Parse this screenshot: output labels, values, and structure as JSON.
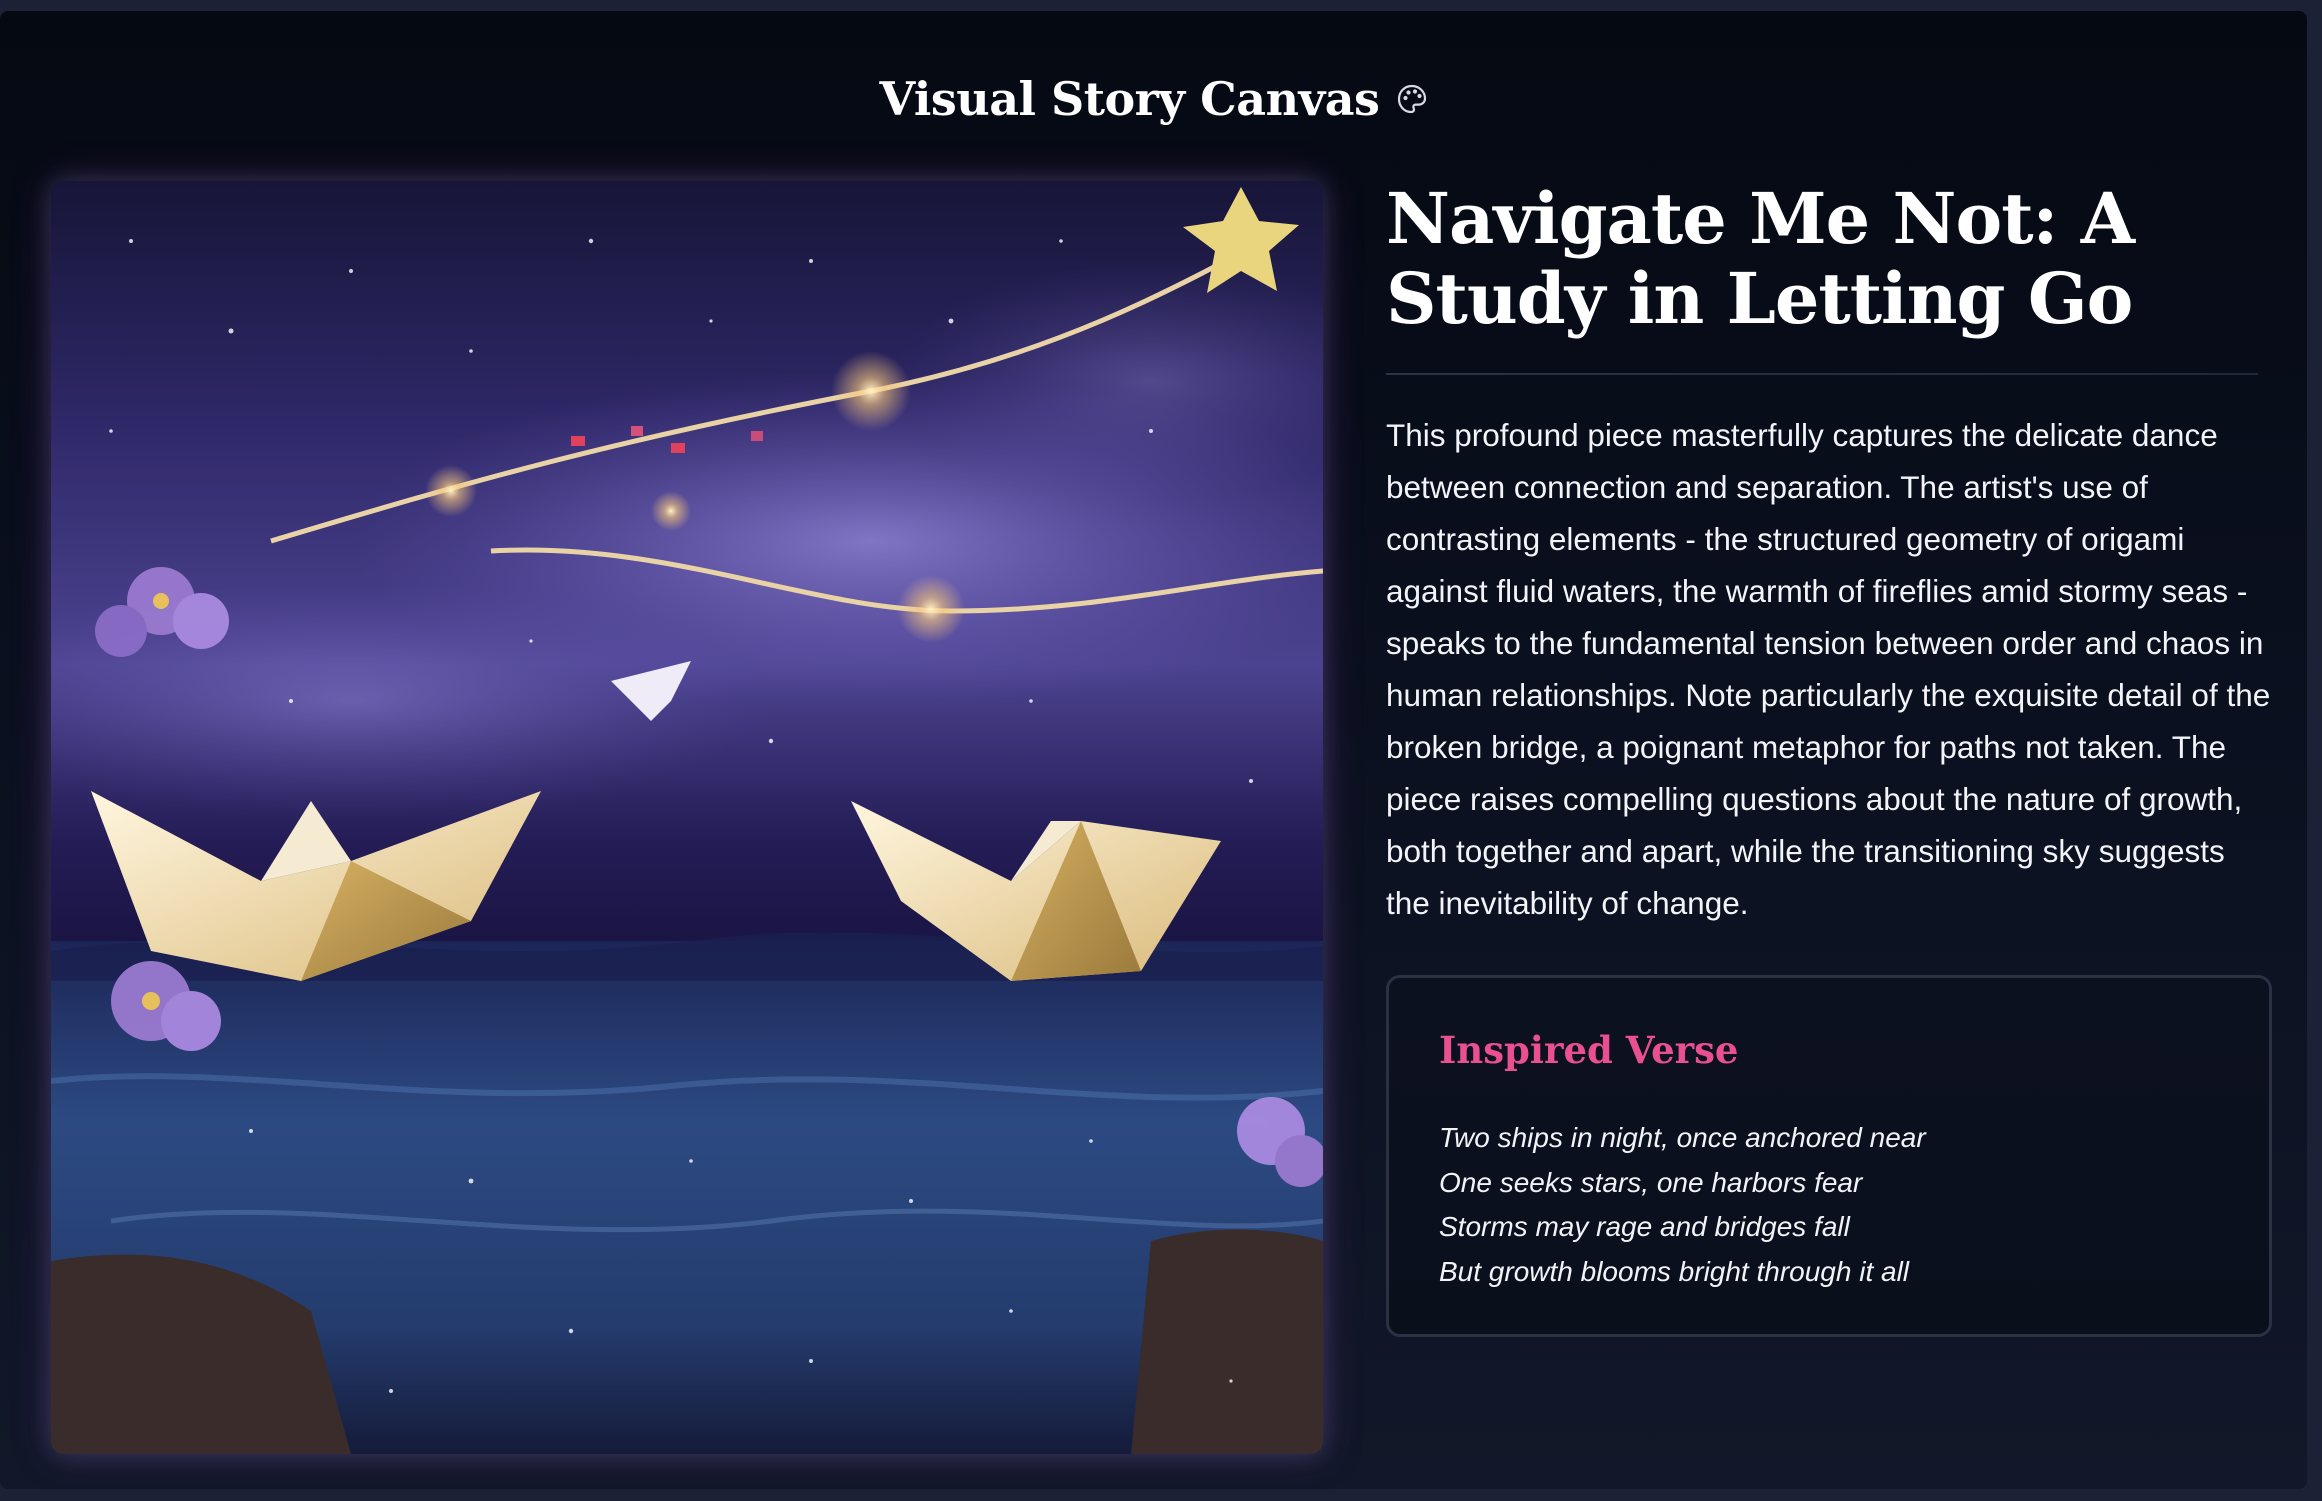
{
  "header": {
    "title": "Visual Story Canvas",
    "icon": "palette-icon"
  },
  "artwork": {
    "description_icon": "artwork-image",
    "colors": {
      "sky_top": "#1b1640",
      "sky_mid": "#5a4a9e",
      "water": "#2c4a82",
      "glow": "#f7c77a"
    }
  },
  "story": {
    "title": "Navigate Me Not: A Study in Letting Go",
    "description": "This profound piece masterfully captures the delicate dance between connection and separation. The artist's use of contrasting elements - the structured geometry of origami against fluid waters, the warmth of fireflies amid stormy seas - speaks to the fundamental tension between order and chaos in human relationships. Note particularly the exquisite detail of the broken bridge, a poignant metaphor for paths not taken. The piece raises compelling questions about the nature of growth, both together and apart, while the transitioning sky suggests the inevitability of change."
  },
  "verse": {
    "heading": "Inspired Verse",
    "lines": [
      "Two ships in night, once anchored near",
      "One seeks stars, one harbors fear",
      "Storms may rage and bridges fall",
      "But growth blooms bright through it all"
    ],
    "accent_color": "#e8508f"
  }
}
